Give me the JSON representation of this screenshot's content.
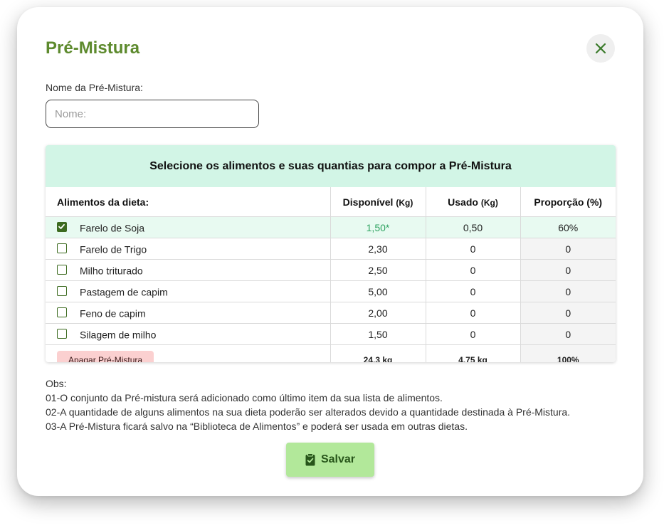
{
  "modal": {
    "title": "Pré-Mistura",
    "close_icon": "close-icon"
  },
  "name_field": {
    "label": "Nome da Pré-Mistura:",
    "placeholder": "Nome:",
    "value": ""
  },
  "table": {
    "heading": "Selecione os alimentos e suas quantias para compor a Pré-Mistura",
    "columns": {
      "food": "Alimentos da dieta:",
      "available": "Disponível",
      "available_unit": "(Kg)",
      "used": "Usado",
      "used_unit": "(Kg)",
      "proportion": "Proporção (%)"
    },
    "rows": [
      {
        "name": "Farelo de Soja",
        "checked": true,
        "available": "1,50*",
        "used": "0,50",
        "proportion": "60%"
      },
      {
        "name": "Farelo de Trigo",
        "checked": false,
        "available": "2,30",
        "used": "0",
        "proportion": "0"
      },
      {
        "name": "Milho triturado",
        "checked": false,
        "available": "2,50",
        "used": "0",
        "proportion": "0"
      },
      {
        "name": "Pastagem de capim",
        "checked": false,
        "available": "5,00",
        "used": "0",
        "proportion": "0"
      },
      {
        "name": "Feno de capim",
        "checked": false,
        "available": "2,00",
        "used": "0",
        "proportion": "0"
      },
      {
        "name": "Silagem de milho",
        "checked": false,
        "available": "1,50",
        "used": "0",
        "proportion": "0"
      }
    ],
    "footer": {
      "delete_label": "Apagar Pré-Mistura",
      "total_available": "24,3 kg",
      "total_used": "4,75 kg",
      "total_proportion": "100%"
    }
  },
  "notes": {
    "title": "Obs:",
    "lines": [
      "01-O conjunto da Pré-mistura será adicionado como último item da sua lista de alimentos.",
      "02-A quantidade de alguns alimentos na sua dieta poderão ser alterados devido a quantidade destinada à Pré-Mistura.",
      "03-A Pré-Mistura ficará salvo na “Biblioteca de Alimentos” e poderá ser usada em outras dietas."
    ]
  },
  "save_button": {
    "label": "Salvar",
    "icon": "clipboard-check-icon"
  },
  "colors": {
    "title": "#5d8a2d",
    "table_header_bg": "#d2f5e6",
    "selected_row_bg": "#e8faf1",
    "highlight_text": "#2fa361",
    "checkbox": "#3d6b20",
    "delete_button_bg": "#fbd0d0",
    "save_button_bg": "#b2e89a",
    "save_button_text": "#27551a"
  }
}
